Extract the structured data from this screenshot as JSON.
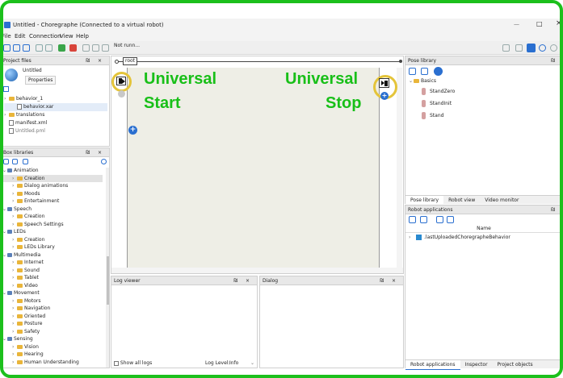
{
  "window": {
    "title": "Untitled - Choregraphe (Connected to a virtual robot)",
    "minimize": "—",
    "maximize": "□",
    "close": "×"
  },
  "menu": [
    "File",
    "Edit",
    "Connection",
    "View",
    "Help"
  ],
  "toolbar": {
    "status": "Not runn..."
  },
  "project_files": {
    "title": "Project files",
    "project_name": "Untitled",
    "properties_label": "Properties",
    "items": [
      {
        "label": "behavior_1",
        "kind": "folder"
      },
      {
        "label": "behavior.xar",
        "kind": "file"
      },
      {
        "label": "translations",
        "kind": "folder"
      },
      {
        "label": "manifest.xml",
        "kind": "file"
      },
      {
        "label": "Untitled.pml",
        "kind": "file"
      }
    ]
  },
  "box_libraries": {
    "title": "Box libraries",
    "items": [
      {
        "label": "Animation",
        "level": 0,
        "selected": false
      },
      {
        "label": "Creation",
        "level": 1,
        "selected": true
      },
      {
        "label": "Dialog animations",
        "level": 1,
        "selected": false
      },
      {
        "label": "Moods",
        "level": 1,
        "selected": false
      },
      {
        "label": "Entertainment",
        "level": 1,
        "selected": false
      },
      {
        "label": "Speech",
        "level": 0,
        "selected": false
      },
      {
        "label": "Creation",
        "level": 1,
        "selected": false
      },
      {
        "label": "Speech Settings",
        "level": 1,
        "selected": false
      },
      {
        "label": "LEDs",
        "level": 0,
        "selected": false
      },
      {
        "label": "Creation",
        "level": 1,
        "selected": false
      },
      {
        "label": "LEDs Library",
        "level": 1,
        "selected": false
      },
      {
        "label": "Multimedia",
        "level": 0,
        "selected": false
      },
      {
        "label": "Internet",
        "level": 1,
        "selected": false
      },
      {
        "label": "Sound",
        "level": 1,
        "selected": false
      },
      {
        "label": "Tablet",
        "level": 1,
        "selected": false
      },
      {
        "label": "Video",
        "level": 1,
        "selected": false
      },
      {
        "label": "Movement",
        "level": 0,
        "selected": false
      },
      {
        "label": "Motors",
        "level": 1,
        "selected": false
      },
      {
        "label": "Navigation",
        "level": 1,
        "selected": false
      },
      {
        "label": "Oriented",
        "level": 1,
        "selected": false
      },
      {
        "label": "Posture",
        "level": 1,
        "selected": false
      },
      {
        "label": "Safety",
        "level": 1,
        "selected": false
      },
      {
        "label": "Sensing",
        "level": 0,
        "selected": false
      },
      {
        "label": "Vision",
        "level": 1,
        "selected": false
      },
      {
        "label": "Hearing",
        "level": 1,
        "selected": false
      },
      {
        "label": "Human Understanding",
        "level": 1,
        "selected": false
      }
    ]
  },
  "flow": {
    "root_label": "root",
    "start_text_1": "Universal",
    "start_text_2": "Start",
    "stop_text_1": "Universal",
    "stop_text_2": "Stop"
  },
  "log_viewer": {
    "title": "Log viewer",
    "show_all_logs": "Show all logs",
    "log_level_label": "Log Level:",
    "log_level_value": "Info"
  },
  "dialog": {
    "title": "Dialog"
  },
  "pose_library": {
    "title": "Pose library",
    "folder": "Basics",
    "poses": [
      "StandZero",
      "StandInit",
      "Stand"
    ],
    "tabs": [
      "Pose library",
      "Robot view",
      "Video monitor"
    ]
  },
  "robot_applications": {
    "title": "Robot applications",
    "column": "Name",
    "items": [
      ".lastUploadedChoregrapheBehavior"
    ],
    "tabs": [
      "Robot applications",
      "Inspector",
      "Project objects"
    ]
  },
  "colors": {
    "highlight": "#1cc01c",
    "accent": "#2a6fd0",
    "canvas": "#eeeee6"
  }
}
